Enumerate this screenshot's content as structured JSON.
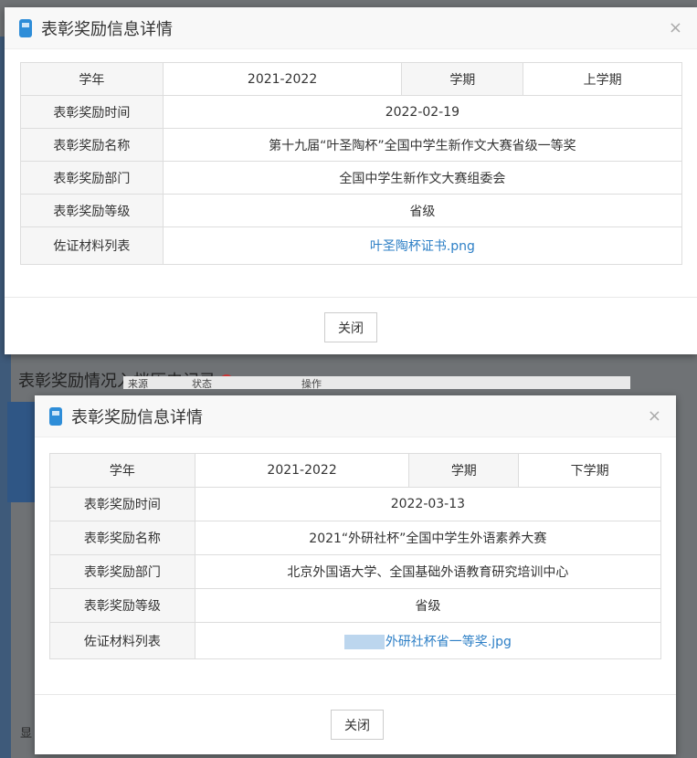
{
  "background": {
    "section_title": "表彰奖励情况入档历史记录",
    "help_icon": "?",
    "columns": [
      "来源",
      "状态",
      "操作"
    ],
    "footer_text": "显"
  },
  "dialogs": [
    {
      "title": "表彰奖励信息详情",
      "close": "×",
      "labels": {
        "year": "学年",
        "term": "学期",
        "time": "表彰奖励时间",
        "name": "表彰奖励名称",
        "dept": "表彰奖励部门",
        "level": "表彰奖励等级",
        "materials": "佐证材料列表"
      },
      "values": {
        "year": "2021-2022",
        "term": "上学期",
        "time": "2022-02-19",
        "name": "第十九届“叶圣陶杯”全国中学生新作文大赛省级一等奖",
        "dept": "全国中学生新作文大赛组委会",
        "level": "省级",
        "materials": "叶圣陶杯证书.png"
      },
      "close_button": "关闭"
    },
    {
      "title": "表彰奖励信息详情",
      "close": "×",
      "labels": {
        "year": "学年",
        "term": "学期",
        "time": "表彰奖励时间",
        "name": "表彰奖励名称",
        "dept": "表彰奖励部门",
        "level": "表彰奖励等级",
        "materials": "佐证材料列表"
      },
      "values": {
        "year": "2021-2022",
        "term": "下学期",
        "time": "2022-03-13",
        "name": "2021“外研社杯”全国中学生外语素养大赛",
        "dept": "北京外国语大学、全国基础外语教育研究培训中心",
        "level": "省级",
        "materials": "外研社杯省一等奖.jpg"
      },
      "close_button": "关闭"
    }
  ]
}
